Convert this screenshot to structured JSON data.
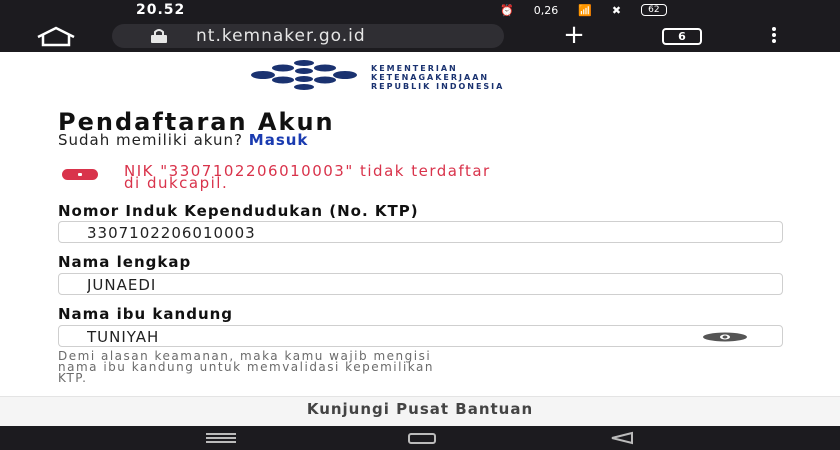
{
  "status_bar": {
    "time": "20.52",
    "speed": "0,26",
    "battery": "62"
  },
  "browser": {
    "url": "nt.kemnaker.go.id",
    "tab_count": "6"
  },
  "logo": {
    "line1": "KEMENTERIAN",
    "line2": "KETENAGAKERJAAN",
    "line3": "REPUBLIK INDONESIA",
    "color": "#1a3270"
  },
  "page": {
    "title": "Pendaftaran Akun",
    "login_prompt": "Sudah memiliki akun?",
    "login_link": "Masuk"
  },
  "alert": {
    "line1": "NIK \"3307102206010003\" tidak terdaftar",
    "line2": "di dukcapil.",
    "color": "#d9334b"
  },
  "form": {
    "nik_label": "Nomor Induk Kependudukan (No. KTP)",
    "nik_value": "3307102206010003",
    "name_label": "Nama lengkap",
    "name_value": "JUNAEDI",
    "mother_label": "Nama ibu kandung",
    "mother_value": "TUNIYAH",
    "hint_line1": "Demi alasan keamanan, maka kamu wajib mengisi",
    "hint_line2": "nama ibu kandung untuk memvalidasi kepemilikan",
    "hint_line3": "KTP."
  },
  "footer": {
    "help_link": "Kunjungi Pusat Bantuan"
  }
}
